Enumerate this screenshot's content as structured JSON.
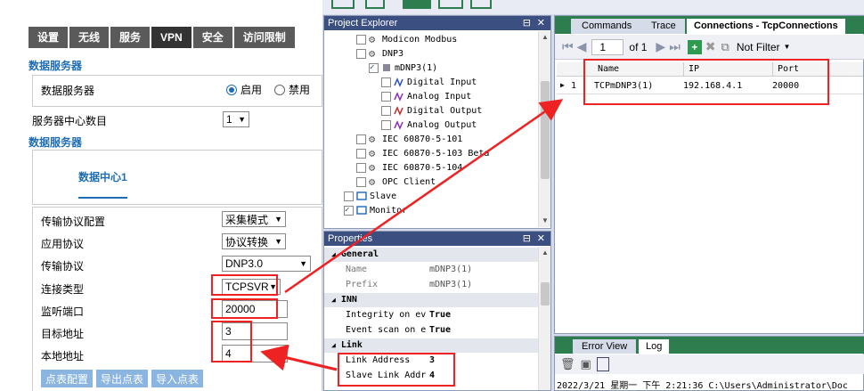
{
  "left": {
    "tabs": [
      "设置",
      "无线",
      "服务",
      "VPN",
      "安全",
      "访问限制"
    ],
    "section_data_server": "数据服务器",
    "data_server_label": "数据服务器",
    "radio_enable": "启用",
    "radio_disable": "禁用",
    "server_center_count_label": "服务器中心数目",
    "server_center_count_value": "1",
    "section_data_server_2": "数据服务器",
    "data_center_tab": "数据中心1",
    "rows": [
      {
        "label": "传输协议配置",
        "value": "采集模式"
      },
      {
        "label": "应用协议",
        "value": "协议转换"
      },
      {
        "label": "传输协议",
        "value": "DNP3.0"
      },
      {
        "label": "连接类型",
        "value": "TCPSVR"
      },
      {
        "label": "监听端口",
        "value": "20000"
      },
      {
        "label": "目标地址",
        "value": "3"
      },
      {
        "label": "本地地址",
        "value": "4"
      }
    ],
    "buttons": [
      "点表配置",
      "导出点表",
      "导入点表"
    ]
  },
  "app": {
    "project_explorer": {
      "title": "Project Explorer",
      "pin": "ꟼ",
      "close": "✕",
      "items": [
        {
          "label": "Modicon Modbus",
          "indent": 2
        },
        {
          "label": "DNP3",
          "indent": 2
        },
        {
          "label": "mDNP3(1)",
          "indent": 3
        },
        {
          "label": "Digital Input",
          "indent": 4
        },
        {
          "label": "Analog Input",
          "indent": 4
        },
        {
          "label": "Digital Output",
          "indent": 4
        },
        {
          "label": "Analog Output",
          "indent": 4
        },
        {
          "label": "IEC 60870-5-101",
          "indent": 2
        },
        {
          "label": "IEC 60870-5-103 Beta",
          "indent": 2
        },
        {
          "label": "IEC 60870-5-104",
          "indent": 2
        },
        {
          "label": "OPC Client",
          "indent": 2
        },
        {
          "label": "Slave",
          "indent": 1
        },
        {
          "label": "Monitor",
          "indent": 1
        }
      ]
    },
    "properties": {
      "title": "Properties",
      "groups": [
        {
          "name": "General",
          "rows": [
            {
              "k": "Name",
              "v": "mDNP3(1)"
            },
            {
              "k": "Prefix",
              "v": "mDNP3(1)"
            }
          ]
        },
        {
          "name": "INN",
          "rows": [
            {
              "k": "Integrity on ev",
              "v": "True"
            },
            {
              "k": "Event scan on e",
              "v": "True"
            }
          ]
        },
        {
          "name": "Link",
          "rows": [
            {
              "k": "Link Address",
              "v": "3"
            },
            {
              "k": "Slave Link Addr",
              "v": "4"
            }
          ]
        }
      ]
    },
    "doc_tabs": [
      "Commands",
      "Trace",
      "Connections - TcpConnections"
    ],
    "pager": {
      "page": "1",
      "of": "of 1",
      "filter": "Not Filter"
    },
    "grid": {
      "headers": [
        "Name",
        "IP",
        "Port"
      ],
      "rows": [
        {
          "index": "1",
          "name": "TCPmDNP3(1)",
          "ip": "192.168.4.1",
          "port": "20000"
        }
      ]
    },
    "bottom_tabs": [
      "Error View",
      "Log"
    ],
    "log_line": "2022/3/21 星期一 下午 2:21:36  C:\\Users\\Administrator\\Doc"
  },
  "colors": {
    "accent_blue": "#1e6db4",
    "button_blue": "#8ab5e0",
    "tab_dark": "#5a5a5a",
    "highlight_red": "#e22222",
    "panel_header": "#3b4f81",
    "doc_tab_green": "#2e7d4f"
  }
}
